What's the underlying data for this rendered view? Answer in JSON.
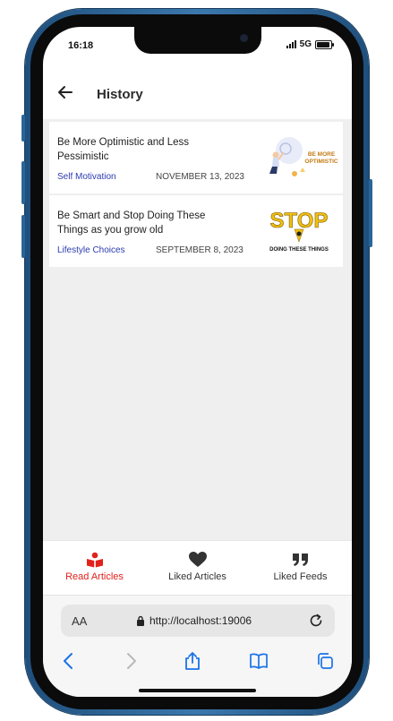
{
  "status": {
    "time": "16:18",
    "network": "5G"
  },
  "header": {
    "title": "History"
  },
  "articles": [
    {
      "title": "Be More Optimistic and Less Pessimistic",
      "category": "Self Motivation",
      "date": "NOVEMBER 13, 2023",
      "thumb_text": [
        "BE MORE",
        "OPTIMISTIC"
      ]
    },
    {
      "title": "Be Smart and Stop Doing These Things as you grow old",
      "category": "Lifestyle Choices",
      "date": "SEPTEMBER 8, 2023",
      "thumb_text": [
        "STOP",
        "DOING THESE THINGS"
      ]
    }
  ],
  "tabs": [
    {
      "label": "Read Articles",
      "icon": "book-icon",
      "active": true
    },
    {
      "label": "Liked Articles",
      "icon": "heart-icon",
      "active": false
    },
    {
      "label": "Liked Feeds",
      "icon": "quote-icon",
      "active": false
    }
  ],
  "browser": {
    "aa_label": "AA",
    "url": "http://localhost:19006"
  },
  "colors": {
    "accent": "#e1221c",
    "category": "#2b3bb0",
    "background": "#efefef"
  }
}
